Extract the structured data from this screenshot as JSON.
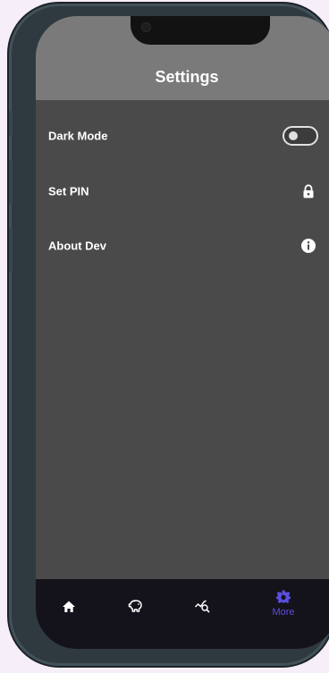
{
  "app_bar": {
    "title": "Settings"
  },
  "settings": {
    "items": [
      {
        "label": "Dark Mode",
        "control": "toggle",
        "toggle_on": false
      },
      {
        "label": "Set PIN",
        "icon": "lock-icon"
      },
      {
        "label": "About Dev",
        "icon": "info-icon"
      }
    ]
  },
  "bottom_nav": {
    "items": [
      {
        "icon": "home-icon",
        "label": ""
      },
      {
        "icon": "piggy-bank-icon",
        "label": ""
      },
      {
        "icon": "chart-search-icon",
        "label": ""
      },
      {
        "icon": "gear-icon",
        "label": "More",
        "active": true
      }
    ]
  },
  "colors": {
    "app_bar": "#7a7a7a",
    "background": "#4a4a4a",
    "nav_background": "#14121a",
    "accent": "#5b4fe0",
    "text": "#ffffff"
  }
}
